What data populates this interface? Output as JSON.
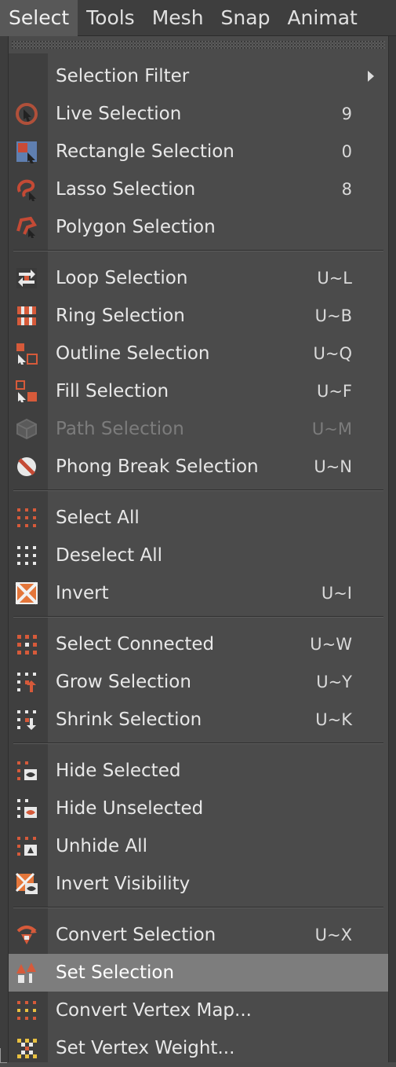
{
  "menubar": {
    "items": [
      {
        "label": "Select",
        "active": true
      },
      {
        "label": "Tools"
      },
      {
        "label": "Mesh"
      },
      {
        "label": "Snap"
      },
      {
        "label": "Animat"
      }
    ]
  },
  "menu": {
    "items": [
      {
        "label": "Selection Filter",
        "shortcut": "",
        "submenu": true,
        "icon": "none"
      },
      {
        "label": "Live Selection",
        "shortcut": "9",
        "icon": "live-selection-icon"
      },
      {
        "label": "Rectangle Selection",
        "shortcut": "0",
        "icon": "rectangle-selection-icon"
      },
      {
        "label": "Lasso Selection",
        "shortcut": "8",
        "icon": "lasso-selection-icon"
      },
      {
        "label": "Polygon Selection",
        "shortcut": "",
        "icon": "polygon-selection-icon"
      },
      {
        "label": "Loop Selection",
        "shortcut": "U~L",
        "icon": "loop-selection-icon"
      },
      {
        "label": "Ring Selection",
        "shortcut": "U~B",
        "icon": "ring-selection-icon"
      },
      {
        "label": "Outline Selection",
        "shortcut": "U~Q",
        "icon": "outline-selection-icon"
      },
      {
        "label": "Fill Selection",
        "shortcut": "U~F",
        "icon": "fill-selection-icon"
      },
      {
        "label": "Path Selection",
        "shortcut": "U~M",
        "icon": "path-selection-icon",
        "disabled": true
      },
      {
        "label": "Phong Break Selection",
        "shortcut": "U~N",
        "icon": "phong-break-selection-icon"
      },
      {
        "label": "Select All",
        "shortcut": "",
        "icon": "select-all-icon"
      },
      {
        "label": "Deselect All",
        "shortcut": "",
        "icon": "deselect-all-icon"
      },
      {
        "label": "Invert",
        "shortcut": "U~I",
        "icon": "invert-icon"
      },
      {
        "label": "Select Connected",
        "shortcut": "U~W",
        "icon": "select-connected-icon"
      },
      {
        "label": "Grow Selection",
        "shortcut": "U~Y",
        "icon": "grow-selection-icon"
      },
      {
        "label": "Shrink Selection",
        "shortcut": "U~K",
        "icon": "shrink-selection-icon"
      },
      {
        "label": "Hide Selected",
        "shortcut": "",
        "icon": "hide-selected-icon"
      },
      {
        "label": "Hide Unselected",
        "shortcut": "",
        "icon": "hide-unselected-icon"
      },
      {
        "label": "Unhide All",
        "shortcut": "",
        "icon": "unhide-all-icon"
      },
      {
        "label": "Invert Visibility",
        "shortcut": "",
        "icon": "invert-visibility-icon"
      },
      {
        "label": "Convert Selection",
        "shortcut": "U~X",
        "icon": "convert-selection-icon"
      },
      {
        "label": "Set Selection",
        "shortcut": "",
        "icon": "set-selection-icon",
        "highlighted": true
      },
      {
        "label": "Convert Vertex Map...",
        "shortcut": "",
        "icon": "convert-vertex-map-icon"
      },
      {
        "label": "Set Vertex Weight...",
        "shortcut": "",
        "icon": "set-vertex-weight-icon"
      }
    ]
  },
  "colors": {
    "accent": "#e0562a",
    "highlight": "#7d7d7d",
    "menu_bg": "#4b4b4b"
  }
}
